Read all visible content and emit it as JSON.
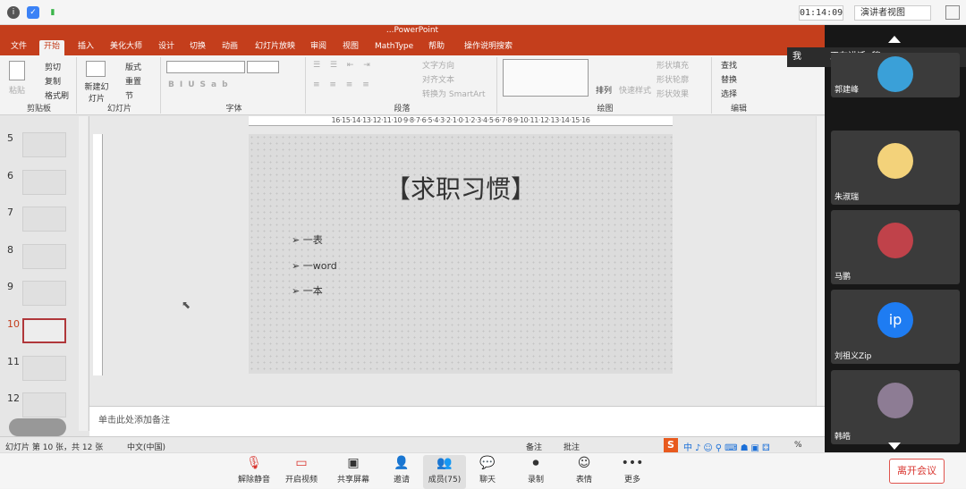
{
  "topbar": {
    "timer": "01:14:09",
    "presenter_view": "演讲者视图"
  },
  "ppt": {
    "title": "...PowerPoint",
    "tabs": [
      "文件",
      "开始",
      "插入",
      "美化大师",
      "设计",
      "切换",
      "动画",
      "幻灯片放映",
      "审阅",
      "视图",
      "MathType",
      "帮助",
      "操作说明搜索"
    ],
    "active_tab": "开始",
    "groups": {
      "clipboard": {
        "label": "剪贴板",
        "paste": "粘贴",
        "cut": "剪切",
        "copy": "复制",
        "format_painter": "格式刷"
      },
      "slides": {
        "label": "幻灯片",
        "new_slide": "新建幻灯片",
        "layout": "版式",
        "reset": "重置",
        "section": "节"
      },
      "font": {
        "label": "字体"
      },
      "paragraph": {
        "label": "段落",
        "text_direction": "文字方向",
        "align_text": "对齐文本",
        "smartart": "转换为 SmartArt"
      },
      "drawing": {
        "label": "绘图",
        "arrange": "排列",
        "quick_styles": "快速样式",
        "fill": "形状填充",
        "outline": "形状轮廓",
        "effects": "形状效果"
      },
      "editing": {
        "label": "编辑",
        "find": "查找",
        "replace": "替换",
        "select": "选择"
      }
    },
    "ruler_h": "16·15·14·13·12·11·10·9·8·7·6·5·4·3·2·1·0·1·2·3·4·5·6·7·8·9·10·11·12·13·14·15·16",
    "thumbnails": [
      {
        "num": "5",
        "star": "★"
      },
      {
        "num": "6",
        "star": "★"
      },
      {
        "num": "7",
        "star": "★"
      },
      {
        "num": "8",
        "star": "★"
      },
      {
        "num": "9",
        "star": "★"
      },
      {
        "num": "10",
        "star": "★"
      },
      {
        "num": "11",
        "star": "★"
      },
      {
        "num": "12",
        "star": "★"
      }
    ],
    "slide": {
      "title": "【求职习惯】",
      "bullets": [
        "一表",
        "一word",
        "一本"
      ],
      "bullet_mark": "➢"
    },
    "notes_placeholder": "单击此处添加备注",
    "status": {
      "slide_info": "幻灯片 第 10 张，共 12 张",
      "language": "中文(中国)",
      "notes": "备注",
      "comments": "批注",
      "zoom_pct": "%"
    }
  },
  "panel": {
    "me": "我",
    "speaking": "正在讲话: 穆;",
    "participants": [
      {
        "name": "郭建峰",
        "color": "#3aa0d8"
      },
      {
        "name": "朱淑瑞",
        "color": "#f3d27a"
      },
      {
        "name": "马鹏",
        "color": "#c0424a"
      },
      {
        "name": "刘祖义Zip",
        "initials": "ip",
        "color": "#1e7cf2"
      },
      {
        "name": "韩皓",
        "color": "#8d7c94"
      }
    ]
  },
  "bottombar": {
    "buttons": [
      "解除静音",
      "开启视频",
      "共享屏幕",
      "邀请",
      "成员(75)",
      "聊天",
      "录制",
      "表情",
      "更多"
    ],
    "leave": "离开会议"
  }
}
